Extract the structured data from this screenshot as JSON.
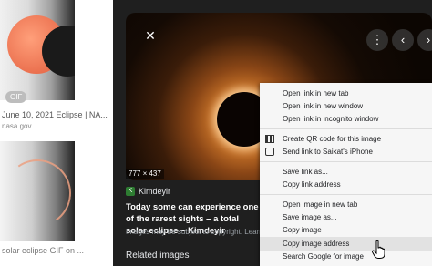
{
  "left_column": {
    "badge": "GIF",
    "caption1": "June 10, 2021 Eclipse | NA...",
    "source1": "nasa.gov",
    "caption2": "solar eclipse GIF on ..."
  },
  "viewer": {
    "dimensions": "777 × 437",
    "site_name": "Kimdeyir",
    "site_icon": "K",
    "title": "Today some can experience one of the rarest sights – a total solar eclipse – Kimdeyir",
    "copyright_notice": "Images may be subject to copyright. Learn More",
    "related_heading": "Related images"
  },
  "icons": {
    "close": "close-icon",
    "more": "more-vertical-icon",
    "prev": "chevron-left-icon",
    "next": "chevron-right-icon",
    "qr": "qr-code-icon",
    "device": "device-icon",
    "cursor": "hand-pointer-icon"
  },
  "context_menu": {
    "items": [
      "Open link in new tab",
      "Open link in new window",
      "Open link in incognito window",
      "Create QR code for this image",
      "Send link to Saikat's iPhone",
      "Save link as...",
      "Copy link address",
      "Open image in new tab",
      "Save image as...",
      "Copy image",
      "Copy image address",
      "Search Google for image"
    ],
    "highlighted_index": 10
  },
  "colors": {
    "panel_bg": "#1f1f1f",
    "menu_bg": "#f6f6f6",
    "highlight": "#e2e2e2",
    "site_icon": "#2e7d32"
  }
}
